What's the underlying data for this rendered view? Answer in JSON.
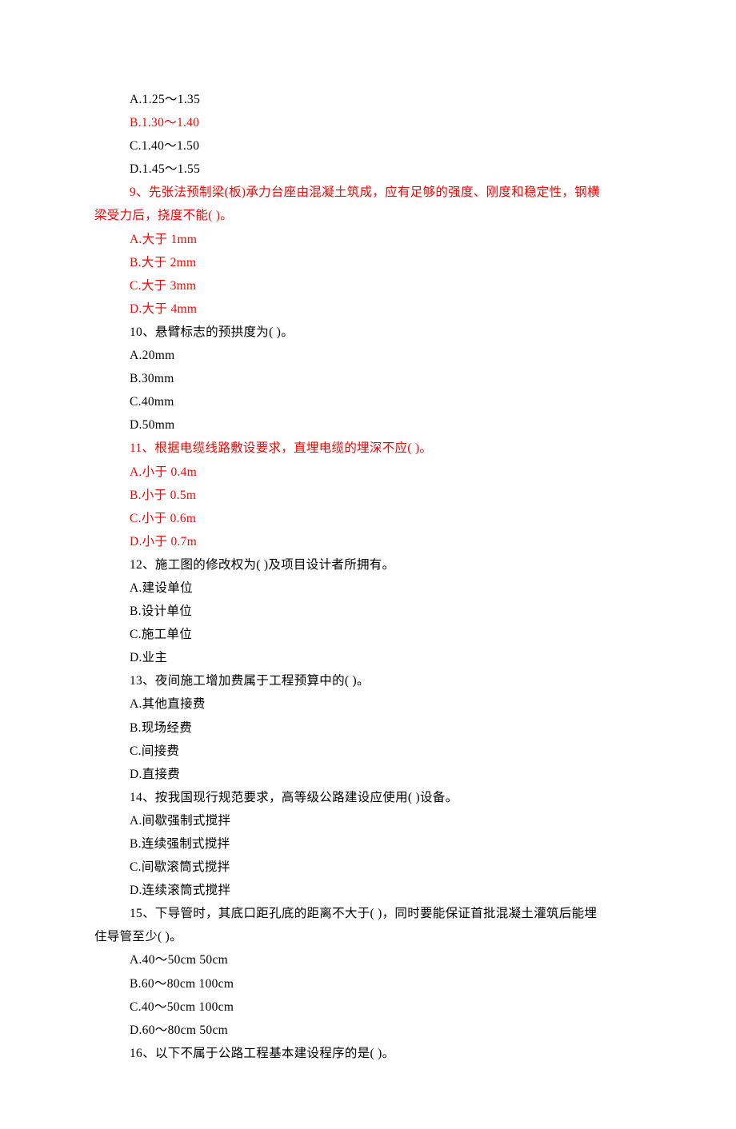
{
  "lines": [
    {
      "text": "A.1.25～1.35",
      "red": false,
      "indent": 1
    },
    {
      "text": "B.1.30～1.40",
      "red": true,
      "indent": 1
    },
    {
      "text": "C.1.40～1.50",
      "red": false,
      "indent": 1
    },
    {
      "text": "D.1.45～1.55",
      "red": false,
      "indent": 1
    },
    {
      "text": "9、先张法预制梁(板)承力台座由混凝土筑成，应有足够的强度、刚度和稳定性，钢横",
      "red": true,
      "indent": 1
    },
    {
      "text": "梁受力后，挠度不能( )。",
      "red": true,
      "indent": 0
    },
    {
      "text": "A.大于 1mm",
      "red": true,
      "indent": 1
    },
    {
      "text": "B.大于 2mm",
      "red": true,
      "indent": 1
    },
    {
      "text": "C.大于 3mm",
      "red": true,
      "indent": 1
    },
    {
      "text": "D.大于 4mm",
      "red": true,
      "indent": 1
    },
    {
      "text": "10、悬臂标志的预拱度为( )。",
      "red": false,
      "indent": 1
    },
    {
      "text": "A.20mm",
      "red": false,
      "indent": 1
    },
    {
      "text": "B.30mm",
      "red": false,
      "indent": 1
    },
    {
      "text": "C.40mm",
      "red": false,
      "indent": 1
    },
    {
      "text": "D.50mm",
      "red": false,
      "indent": 1
    },
    {
      "text": "11、根据电缆线路敷设要求，直埋电缆的埋深不应( )。",
      "red": true,
      "indent": 1
    },
    {
      "text": "A.小于 0.4m",
      "red": true,
      "indent": 1
    },
    {
      "text": "B.小于 0.5m",
      "red": true,
      "indent": 1
    },
    {
      "text": "C.小于 0.6m",
      "red": true,
      "indent": 1
    },
    {
      "text": "D.小于 0.7m",
      "red": true,
      "indent": 1
    },
    {
      "text": "12、施工图的修改权为( )及项目设计者所拥有。",
      "red": false,
      "indent": 1
    },
    {
      "text": "A.建设单位",
      "red": false,
      "indent": 1
    },
    {
      "text": "B.设计单位",
      "red": false,
      "indent": 1
    },
    {
      "text": "C.施工单位",
      "red": false,
      "indent": 1
    },
    {
      "text": "D.业主",
      "red": false,
      "indent": 1
    },
    {
      "text": "13、夜间施工增加费属于工程预算中的( )。",
      "red": false,
      "indent": 1
    },
    {
      "text": "A.其他直接费",
      "red": false,
      "indent": 1
    },
    {
      "text": "B.现场经费",
      "red": false,
      "indent": 1
    },
    {
      "text": "C.间接费",
      "red": false,
      "indent": 1
    },
    {
      "text": "D.直接费",
      "red": false,
      "indent": 1
    },
    {
      "text": "14、按我国现行规范要求，高等级公路建设应使用( )设备。",
      "red": false,
      "indent": 1
    },
    {
      "text": "A.间歇强制式搅拌",
      "red": false,
      "indent": 1
    },
    {
      "text": "B.连续强制式搅拌",
      "red": false,
      "indent": 1
    },
    {
      "text": "C.间歇滚筒式搅拌",
      "red": false,
      "indent": 1
    },
    {
      "text": "D.连续滚筒式搅拌",
      "red": false,
      "indent": 1
    },
    {
      "text": "15、下导管时，其底口距孔底的距离不大于( )，同时要能保证首批混凝土灌筑后能埋",
      "red": false,
      "indent": 1
    },
    {
      "text": "住导管至少( )。",
      "red": false,
      "indent": 0
    },
    {
      "text": "A.40～50cm 50cm",
      "red": false,
      "indent": 1
    },
    {
      "text": "B.60～80cm 100cm",
      "red": false,
      "indent": 1
    },
    {
      "text": "C.40～50cm 100cm",
      "red": false,
      "indent": 1
    },
    {
      "text": "D.60～80cm 50cm",
      "red": false,
      "indent": 1
    },
    {
      "text": "16、以下不属于公路工程基本建设程序的是( )。",
      "red": false,
      "indent": 1
    }
  ]
}
